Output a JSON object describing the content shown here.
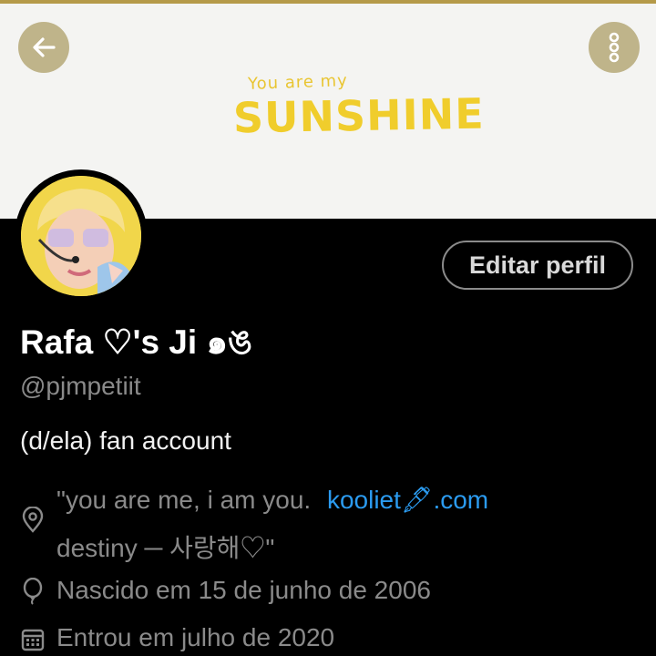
{
  "banner": {
    "small_text": "You are my",
    "big_text": "SUNSHINE"
  },
  "profile": {
    "edit_button": "Editar perfil",
    "name": "Rafa ♡'s Ji ๑ঙ",
    "handle": "@pjmpetiit",
    "bio": "(d/ela) fan account"
  },
  "location": {
    "text_line1": "\"you are me, i am you.",
    "link": "kooliet🖋.com",
    "text_line2": "destiny ─ 사랑해♡\""
  },
  "birth": "Nascido em 15 de junho de 2006",
  "joined": "Entrou em julho de 2020",
  "colors": {
    "accent_gold": "#b59a49",
    "button_gold": "#bfb48a",
    "link_blue": "#2b9bf0",
    "background": "#000000"
  },
  "icons": {
    "back": "arrow-left-icon",
    "more": "more-vertical-icon",
    "location": "location-pin-icon",
    "birth": "balloon-icon",
    "joined": "calendar-icon"
  }
}
